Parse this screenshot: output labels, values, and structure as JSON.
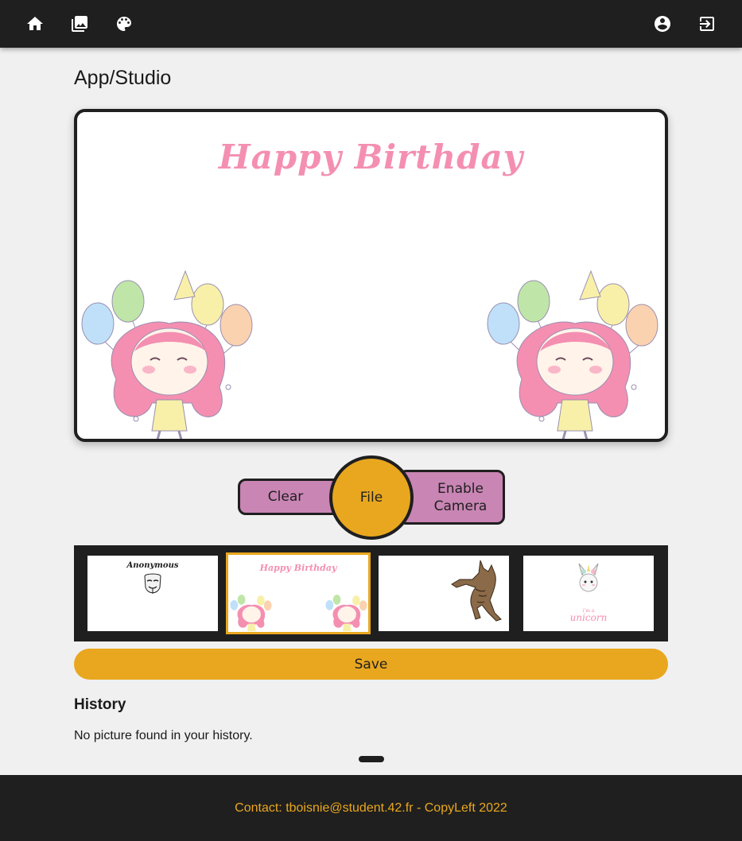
{
  "nav": {
    "left": [
      {
        "icon": "home-icon"
      },
      {
        "icon": "gallery-icon"
      },
      {
        "icon": "palette-icon"
      }
    ],
    "right": [
      {
        "icon": "account-circle-icon"
      },
      {
        "icon": "logout-icon"
      }
    ]
  },
  "page": {
    "title": "App/Studio"
  },
  "preview": {
    "overlay_text": "Happy Birthday"
  },
  "controls": {
    "clear_label": "Clear",
    "file_label": "File",
    "camera_label": "Enable\nCamera"
  },
  "filters": [
    {
      "name": "anonymous",
      "text": "Anonymous",
      "selected": false
    },
    {
      "name": "happy-birthday",
      "text": "Happy Birthday",
      "selected": true
    },
    {
      "name": "cat",
      "selected": false
    },
    {
      "name": "unicorn",
      "small_text": "i'm a",
      "text": "unicorn",
      "selected": false
    }
  ],
  "save": {
    "label": "Save"
  },
  "history": {
    "title": "History",
    "empty_text": "No picture found in your history."
  },
  "footer": {
    "text": "Contact: tboisnie@student.42.fr - CopyLeft 2022"
  },
  "colors": {
    "topbar": "#1f1f1f",
    "accent": "#e9a71f",
    "pill": "#c985b4",
    "pink": "#f48fb1",
    "background": "#f0f0f0"
  }
}
